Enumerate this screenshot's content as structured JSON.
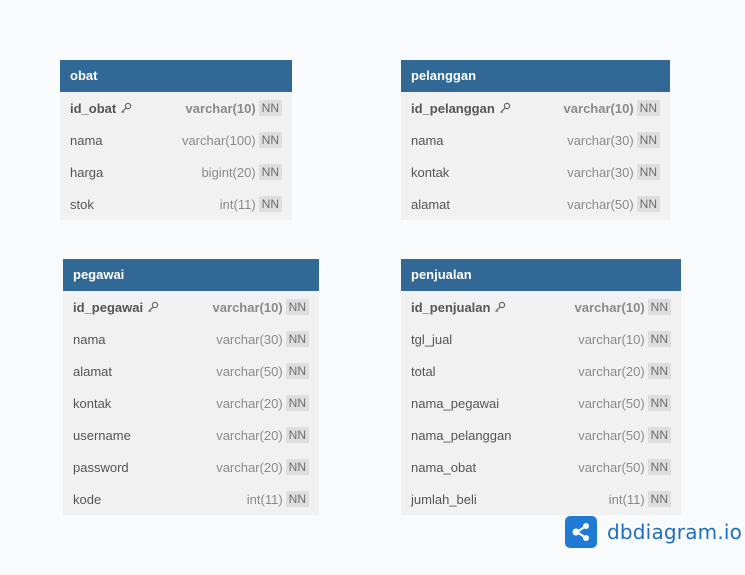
{
  "tables": {
    "obat": {
      "name": "obat",
      "columns": [
        {
          "name": "id_obat",
          "type": "varchar(10)",
          "nn": "NN",
          "pk": true
        },
        {
          "name": "nama",
          "type": "varchar(100)",
          "nn": "NN"
        },
        {
          "name": "harga",
          "type": "bigint(20)",
          "nn": "NN"
        },
        {
          "name": "stok",
          "type": "int(11)",
          "nn": "NN"
        }
      ]
    },
    "pelanggan": {
      "name": "pelanggan",
      "columns": [
        {
          "name": "id_pelanggan",
          "type": "varchar(10)",
          "nn": "NN",
          "pk": true
        },
        {
          "name": "nama",
          "type": "varchar(30)",
          "nn": "NN"
        },
        {
          "name": "kontak",
          "type": "varchar(30)",
          "nn": "NN"
        },
        {
          "name": "alamat",
          "type": "varchar(50)",
          "nn": "NN"
        }
      ]
    },
    "pegawai": {
      "name": "pegawai",
      "columns": [
        {
          "name": "id_pegawai",
          "type": "varchar(10)",
          "nn": "NN",
          "pk": true
        },
        {
          "name": "nama",
          "type": "varchar(30)",
          "nn": "NN"
        },
        {
          "name": "alamat",
          "type": "varchar(50)",
          "nn": "NN"
        },
        {
          "name": "kontak",
          "type": "varchar(20)",
          "nn": "NN"
        },
        {
          "name": "username",
          "type": "varchar(20)",
          "nn": "NN"
        },
        {
          "name": "password",
          "type": "varchar(20)",
          "nn": "NN"
        },
        {
          "name": "kode",
          "type": "int(11)",
          "nn": "NN"
        }
      ]
    },
    "penjualan": {
      "name": "penjualan",
      "columns": [
        {
          "name": "id_penjualan",
          "type": "varchar(10)",
          "nn": "NN",
          "pk": true
        },
        {
          "name": "tgl_jual",
          "type": "varchar(10)",
          "nn": "NN"
        },
        {
          "name": "total",
          "type": "varchar(20)",
          "nn": "NN"
        },
        {
          "name": "nama_pegawai",
          "type": "varchar(50)",
          "nn": "NN"
        },
        {
          "name": "nama_pelanggan",
          "type": "varchar(50)",
          "nn": "NN"
        },
        {
          "name": "nama_obat",
          "type": "varchar(50)",
          "nn": "NN"
        },
        {
          "name": "jumlah_beli",
          "type": "int(11)",
          "nn": "NN"
        }
      ]
    }
  },
  "brand": {
    "text": "dbdiagram.io",
    "icon": "dbdiagram-logo-icon",
    "color": "#1f7ad4"
  },
  "colors": {
    "header": "#316896",
    "body": "#f1f1f1"
  }
}
